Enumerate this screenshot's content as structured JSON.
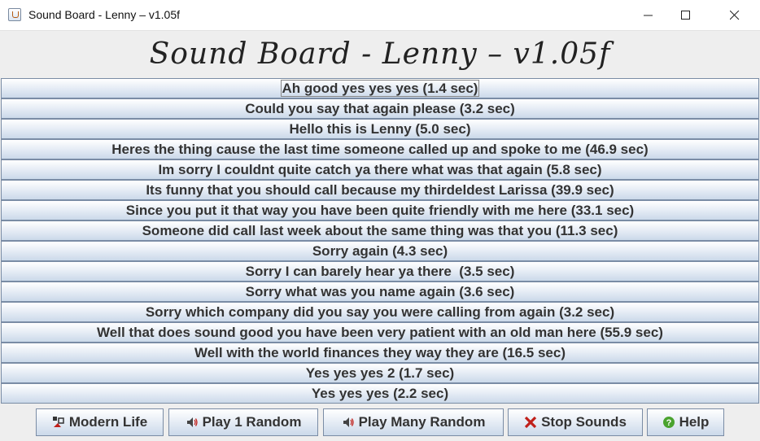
{
  "window": {
    "title": "Sound Board - Lenny – v1.05f",
    "minimize_icon": "minimize-icon",
    "maximize_icon": "maximize-icon",
    "close_icon": "close-icon"
  },
  "heading": "Sound Board - Lenny – v1.05f",
  "sounds": [
    "Ah good yes yes yes (1.4 sec)",
    "Could you say that again please (3.2 sec)",
    "Hello this is Lenny (5.0 sec)",
    "Heres the thing cause the last time someone called up and spoke to me (46.9 sec)",
    "Im sorry I couldnt quite catch ya there what was that again (5.8 sec)",
    "Its funny that you should call because my thirdeldest Larissa (39.9 sec)",
    "Since you put it that way you have been quite friendly with me here (33.1 sec)",
    "Someone did call last week about the same thing was that you (11.3 sec)",
    "Sorry again (4.3 sec)",
    "Sorry I can barely hear ya there  (3.5 sec)",
    "Sorry what was you name again (3.6 sec)",
    "Sorry which company did you say you were calling from again (3.2 sec)",
    "Well that does sound good you have been very patient with an old man here (55.9 sec)",
    "Well with the world finances they way they are (16.5 sec)",
    "Yes yes yes 2 (1.7 sec)",
    "Yes yes yes (2.2 sec)"
  ],
  "actions": {
    "modern_life": {
      "label": "Modern Life",
      "icon": "modern-life-icon"
    },
    "play_random": {
      "label": "Play 1 Random",
      "icon": "speaker-icon"
    },
    "play_many": {
      "label": "Play Many Random",
      "icon": "speaker-icon"
    },
    "stop": {
      "label": "Stop Sounds",
      "icon": "x-icon",
      "color": "#c0201a"
    },
    "help": {
      "label": "Help",
      "icon": "help-icon",
      "color": "#4aa32f"
    }
  }
}
